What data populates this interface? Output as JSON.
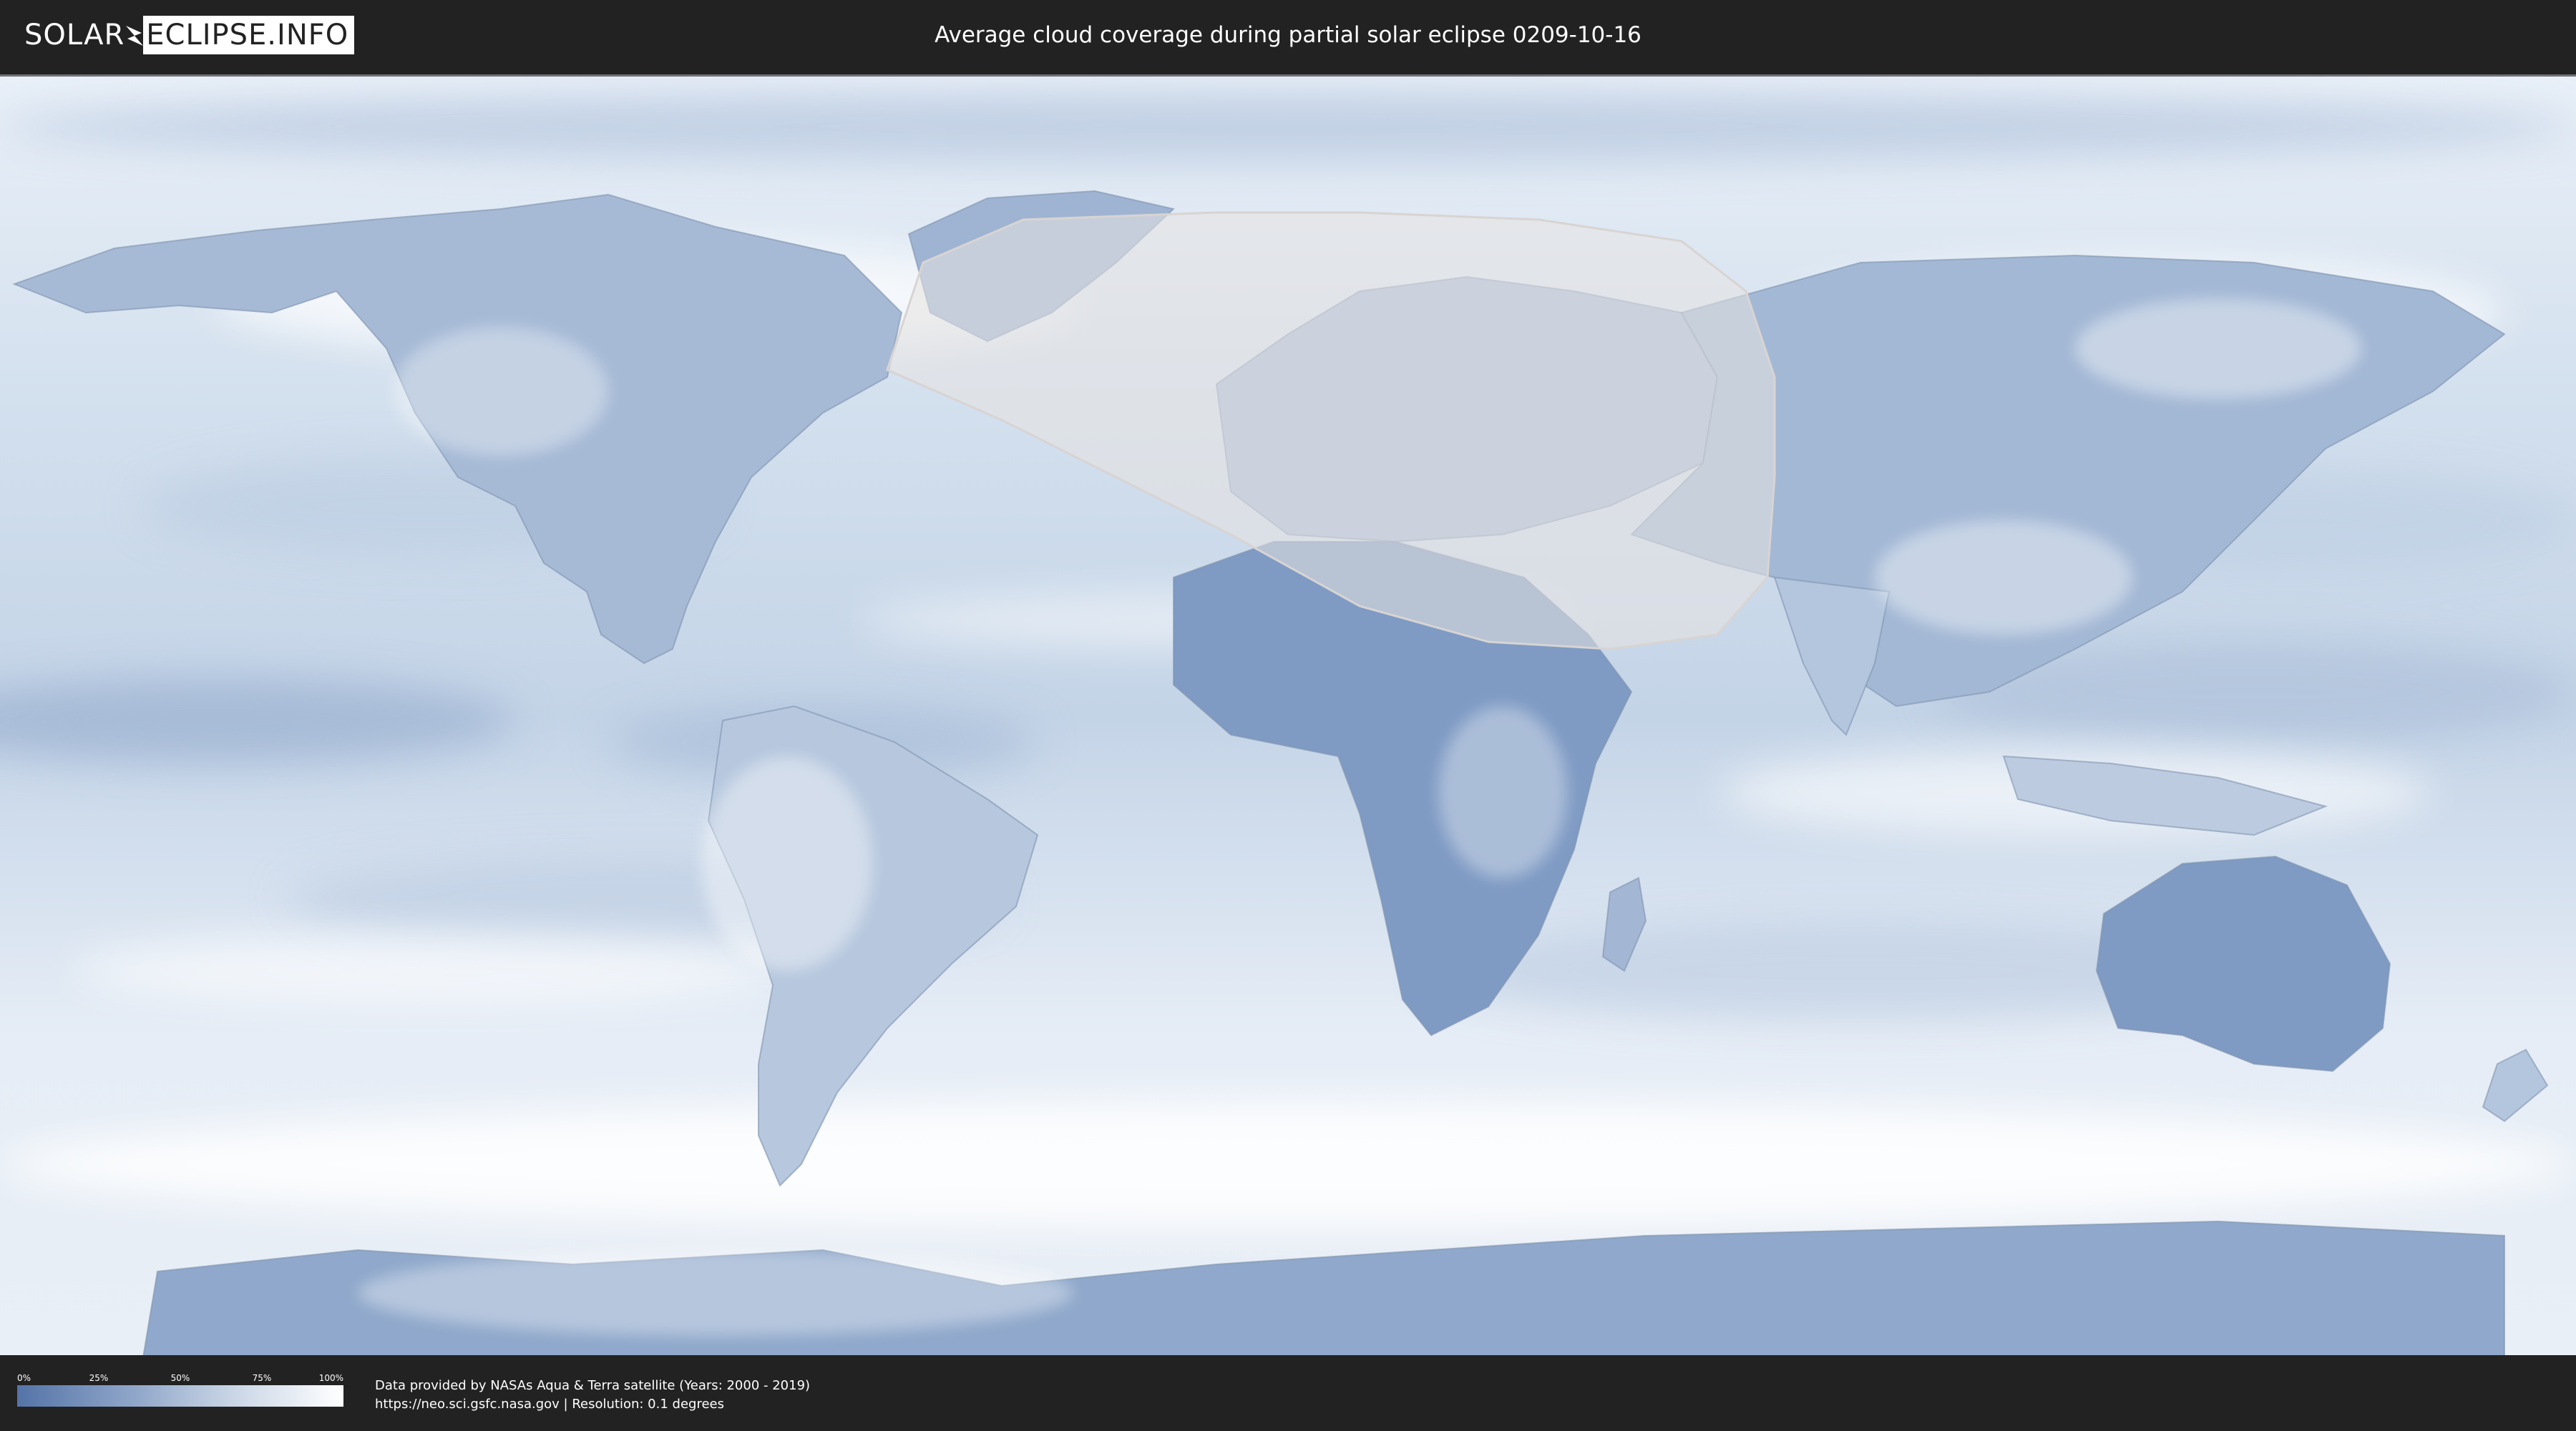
{
  "header": {
    "logo": {
      "part1": "SOLAR",
      "part2": "ECLIPSE.INFO"
    },
    "title": "Average cloud coverage during partial solar eclipse 0209-10-16"
  },
  "map": {
    "eclipse_zone_color": "#e8e4e2",
    "ocean_color": "#dbe6f2",
    "land_color": "#8fa8cb",
    "cloud_color": "#ffffff"
  },
  "legend": {
    "ticks": [
      "0%",
      "25%",
      "50%",
      "75%",
      "100%"
    ],
    "ramp_start": "#5474a7",
    "ramp_end": "#ffffff"
  },
  "footer": {
    "credit_line1": "Data provided by NASAs Aqua & Terra satellite (Years: 2000 - 2019)",
    "credit_line2": "https://neo.sci.gsfc.nasa.gov | Resolution: 0.1 degrees"
  }
}
